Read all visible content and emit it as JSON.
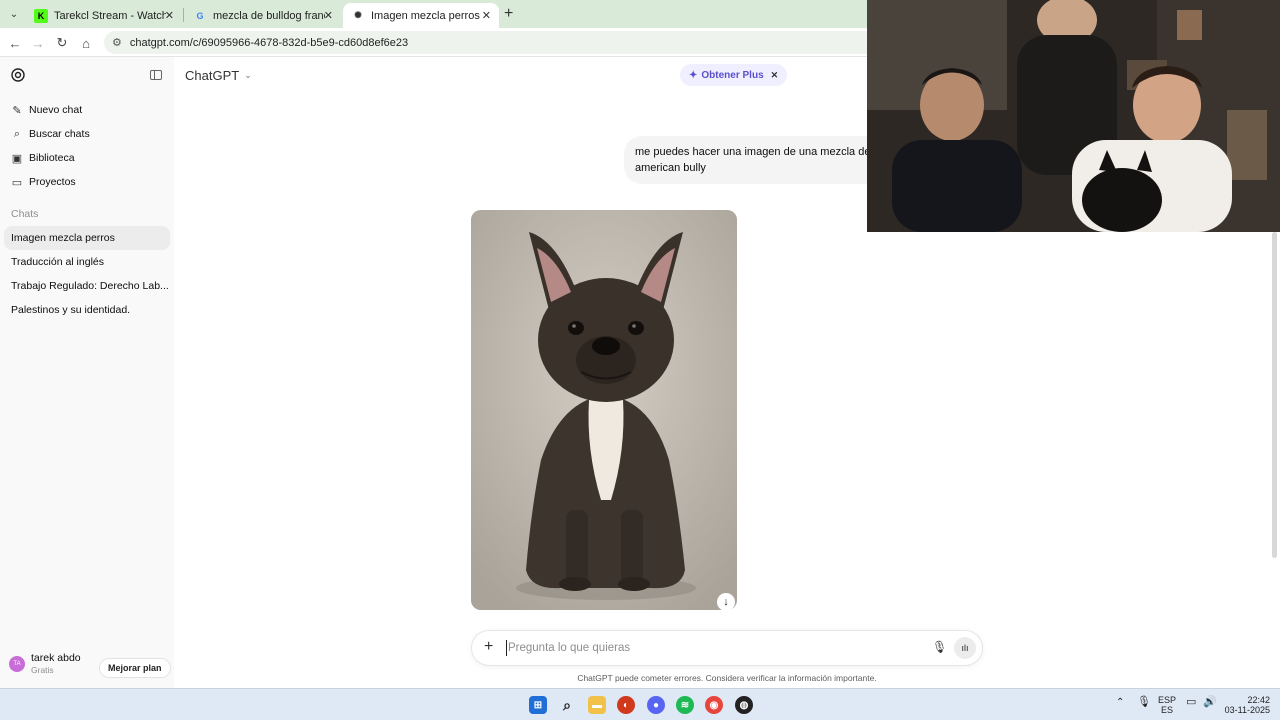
{
  "browser": {
    "tabs": [
      {
        "title": "Tarekcl Stream - Watch Live on",
        "favicon": "kick-icon"
      },
      {
        "title": "mezcla de bulldog frances y am",
        "favicon": "google-icon"
      },
      {
        "title": "Imagen mezcla perros",
        "favicon": "chatgpt-icon"
      }
    ],
    "url": "chatgpt.com/c/69095966-4678-832d-b5e9-cd60d8ef6e23"
  },
  "sidebar": {
    "primary_items": [
      {
        "label": "Nuevo chat",
        "icon": "edit-icon"
      },
      {
        "label": "Buscar chats",
        "icon": "search-icon"
      },
      {
        "label": "Biblioteca",
        "icon": "image-library-icon"
      },
      {
        "label": "Proyectos",
        "icon": "folder-icon"
      }
    ],
    "section_label": "Chats",
    "chats": [
      {
        "label": "Imagen mezcla perros",
        "active": true
      },
      {
        "label": "Traducción al inglés",
        "active": false
      },
      {
        "label": "Trabajo Regulado: Derecho Lab...",
        "active": false
      },
      {
        "label": "Palestinos y su identidad.",
        "active": false
      }
    ],
    "user": {
      "initials": "TA",
      "name": "tarek abdo",
      "plan": "Gratis"
    },
    "upgrade_label": "Mejorar plan"
  },
  "main": {
    "model_name": "ChatGPT",
    "plus_pill": "Obtener Plus",
    "user_message_line1": "me puedes hacer una imagen de una mezcla de b",
    "user_message_line2": "american bully",
    "composer_placeholder": "Pregunta lo que quieras",
    "disclaimer": "ChatGPT puede cometer errores. Considera verificar la información importante."
  },
  "taskbar": {
    "lang_top": "ESP",
    "lang_bottom": "ES",
    "time": "22:42",
    "date": "03-11-2025"
  },
  "colors": {
    "tabbar": "#d9ead9",
    "sidebar": "#f9f9f9",
    "plus_accent": "#5a4fcf",
    "taskbar": "#dfe9f5"
  }
}
